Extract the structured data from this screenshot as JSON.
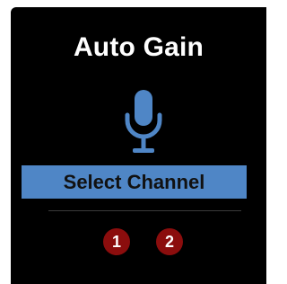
{
  "panel": {
    "title": "Auto Gain",
    "mic_icon": "microphone-icon",
    "select_button_label": "Select Channel",
    "channels": [
      "1",
      "2"
    ],
    "colors": {
      "background": "#000000",
      "title": "#ffffff",
      "accent": "#4f86c6",
      "channel_badge": "#8b0d0d"
    }
  }
}
